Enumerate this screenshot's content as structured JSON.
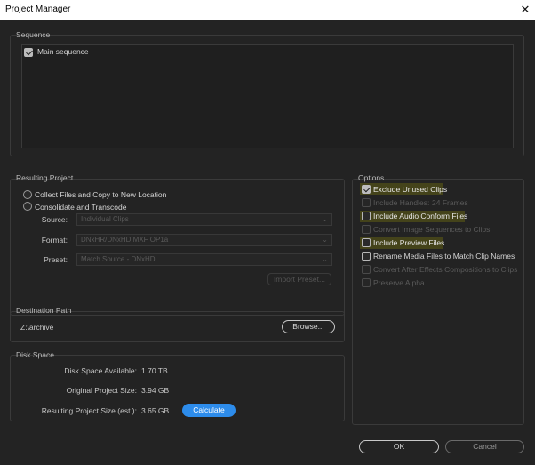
{
  "window": {
    "title": "Project Manager",
    "close_glyph": "✕"
  },
  "sequence": {
    "title": "Sequence",
    "items": [
      {
        "label": "Main sequence",
        "checked": true
      }
    ]
  },
  "resulting_project": {
    "title": "Resulting Project",
    "options": [
      {
        "label": "Collect Files and Copy to New Location",
        "selected": false
      },
      {
        "label": "Consolidate and Transcode",
        "selected": false
      }
    ],
    "source_label": "Source:",
    "source_value": "Individual Clips",
    "format_label": "Format:",
    "format_value": "DNxHR/DNxHD MXF OP1a",
    "preset_label": "Preset:",
    "preset_value": "Match Source - DNxHD",
    "import_preset_label": "Import Preset..."
  },
  "destination": {
    "title": "Destination Path",
    "path": "Z:\\archive",
    "browse_label": "Browse..."
  },
  "disk_space": {
    "title": "Disk Space",
    "available_label": "Disk Space Available:",
    "available_value": "1.70 TB",
    "original_label": "Original Project Size:",
    "original_value": "3.94 GB",
    "resulting_label": "Resulting Project Size (est.):",
    "resulting_value": "3.65 GB",
    "calculate_label": "Calculate"
  },
  "options": {
    "title": "Options",
    "exclude_unused": {
      "label": "Exclude Unused Clips",
      "checked": true,
      "enabled": true,
      "highlighted": true
    },
    "include_handles": {
      "label": "Include Handles:",
      "value": "24 Frames",
      "checked": false,
      "enabled": false
    },
    "include_audio": {
      "label": "Include Audio Conform Files",
      "checked": false,
      "enabled": true,
      "highlighted": true
    },
    "convert_image": {
      "label": "Convert Image Sequences to Clips",
      "checked": false,
      "enabled": false
    },
    "include_preview": {
      "label": "Include Preview Files",
      "checked": false,
      "enabled": true,
      "highlighted": true
    },
    "rename_media": {
      "label": "Rename Media Files to Match Clip Names",
      "checked": false,
      "enabled": true
    },
    "convert_ae": {
      "label": "Convert After Effects Compositions to Clips",
      "checked": false,
      "enabled": false
    },
    "preserve_alpha": {
      "label": "Preserve Alpha",
      "checked": false,
      "enabled": false
    }
  },
  "footer": {
    "ok_label": "OK",
    "cancel_label": "Cancel"
  },
  "colors": {
    "accent_blue": "#2d8ceb",
    "highlight": "#44431a"
  }
}
